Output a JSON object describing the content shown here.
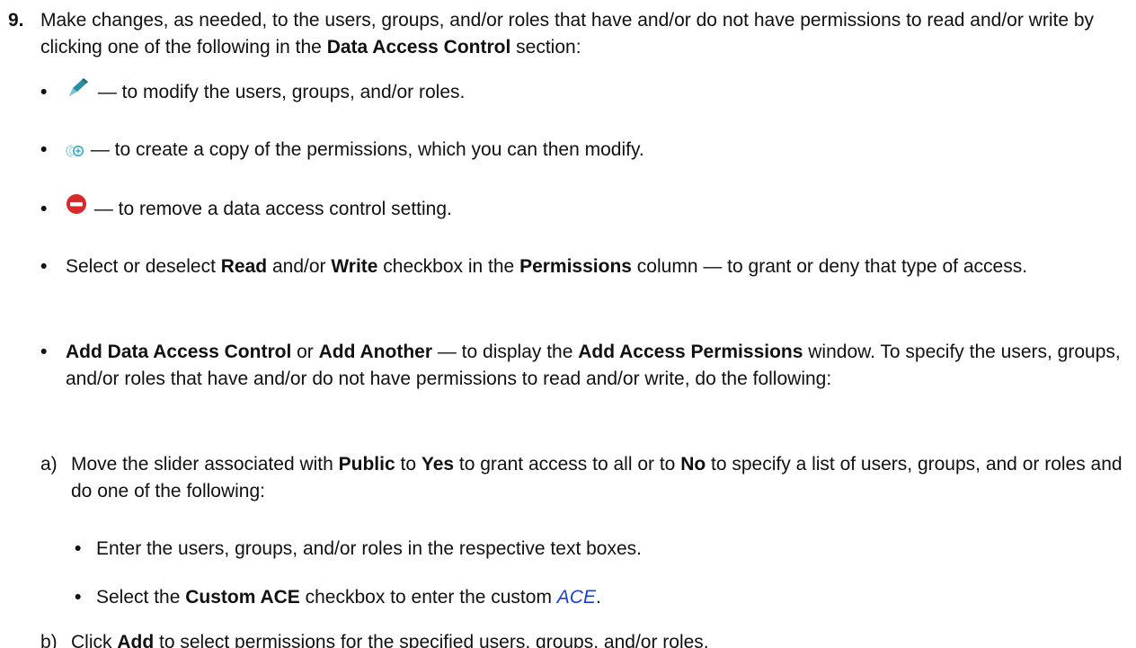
{
  "step": {
    "number": "9.",
    "intro_1": "Make changes, as needed, to the users, groups, and/or roles that have and/or do not have permissions to read and/or write by clicking one of the following in the ",
    "intro_bold": "Data Access Control",
    "intro_2": " section:"
  },
  "bullets": {
    "dot": "•",
    "edit": {
      "icon": "pencil-icon",
      "text": " — to modify the users, groups, and/or roles."
    },
    "copy": {
      "icon": "copy-icon",
      "text": " — to create a copy of the permissions, which you can then modify."
    },
    "remove": {
      "icon": "remove-icon",
      "text": " — to remove a data access control setting."
    },
    "permissions": {
      "t1": "Select or deselect ",
      "b1": "Read",
      "t2": " and/or ",
      "b2": "Write",
      "t3": " checkbox in the ",
      "b3": "Permissions",
      "t4": " column — to grant or deny that type of access."
    },
    "add": {
      "b1": "Add Data Access Control",
      "t1": " or ",
      "b2": "Add Another",
      "t2": " — to display the ",
      "b3": "Add Access Permissions",
      "t3": " window. To specify the users, groups, and/or roles that have and/or do not have permissions to read and/or write, do the following:"
    }
  },
  "substeps": {
    "a": {
      "letter": "a)",
      "t1": "Move the slider associated with ",
      "b1": "Public",
      "t2": " to ",
      "b2": "Yes",
      "t3": " to grant access to all or to ",
      "b3": "No",
      "t4": " to specify a list of users, groups, and or roles and do one of the following:"
    },
    "a_bullets": {
      "enter": "Enter the users, groups, and/or roles in the respective text boxes.",
      "custom_t1": "Select the ",
      "custom_b1": "Custom ACE",
      "custom_t2": " checkbox to enter the custom ",
      "custom_link": "ACE",
      "custom_t3": "."
    },
    "b": {
      "letter": "b)",
      "t1": "Click ",
      "b1": "Add",
      "t2": " to select permissions for the specified users, groups, and/or roles."
    }
  },
  "colors": {
    "pencil": "#2a8fa3",
    "copy": "#3aa7c4",
    "remove": "#d42b2b",
    "link": "#1a3fd6"
  }
}
